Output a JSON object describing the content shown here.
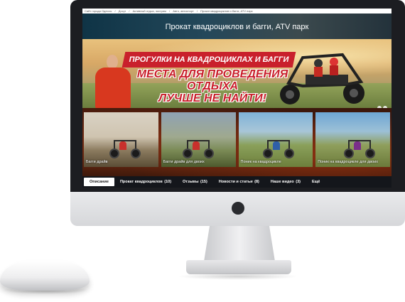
{
  "breadcrumbs": [
    "Сайт города Одессы",
    "/",
    "Досуг",
    "/",
    "Активный отдых, экстрим",
    "/",
    "Авто, автоспорт",
    "/",
    "Прокат квадроциклов и багги, ATV парк"
  ],
  "page_title": "Прокат квадроциклов и багги, ATV парк",
  "hero": {
    "banner_line1": "ПРОГУЛКИ НА КВАДРОЦИКЛАХ И БАГГИ",
    "banner_line2": "МЕСТА ДЛЯ ПРОВЕДЕНИЯ ОТДЫХА",
    "banner_line3": "ЛУЧШЕ НЕ НАЙТИ!"
  },
  "thumbnails": [
    {
      "caption": "Багги драйв"
    },
    {
      "caption": "Багги драйв для двоих"
    },
    {
      "caption": "Поник на квадроцикле"
    },
    {
      "caption": "Поник на квадроцикле для двоих"
    }
  ],
  "tabs": [
    {
      "label": "Описание",
      "count": "",
      "active": true
    },
    {
      "label": "Прокат квадроциклов",
      "count": "(10)",
      "active": false
    },
    {
      "label": "Отзывы",
      "count": "(15)",
      "active": false
    },
    {
      "label": "Новости и статьи",
      "count": "(8)",
      "active": false
    },
    {
      "label": "Наше видео",
      "count": "(3)",
      "active": false
    },
    {
      "label": "Ещё",
      "count": "",
      "active": false
    }
  ],
  "colors": {
    "accent_red": "#c9202c",
    "bezel": "#1c1d21",
    "tab_bar": "#14161b"
  }
}
